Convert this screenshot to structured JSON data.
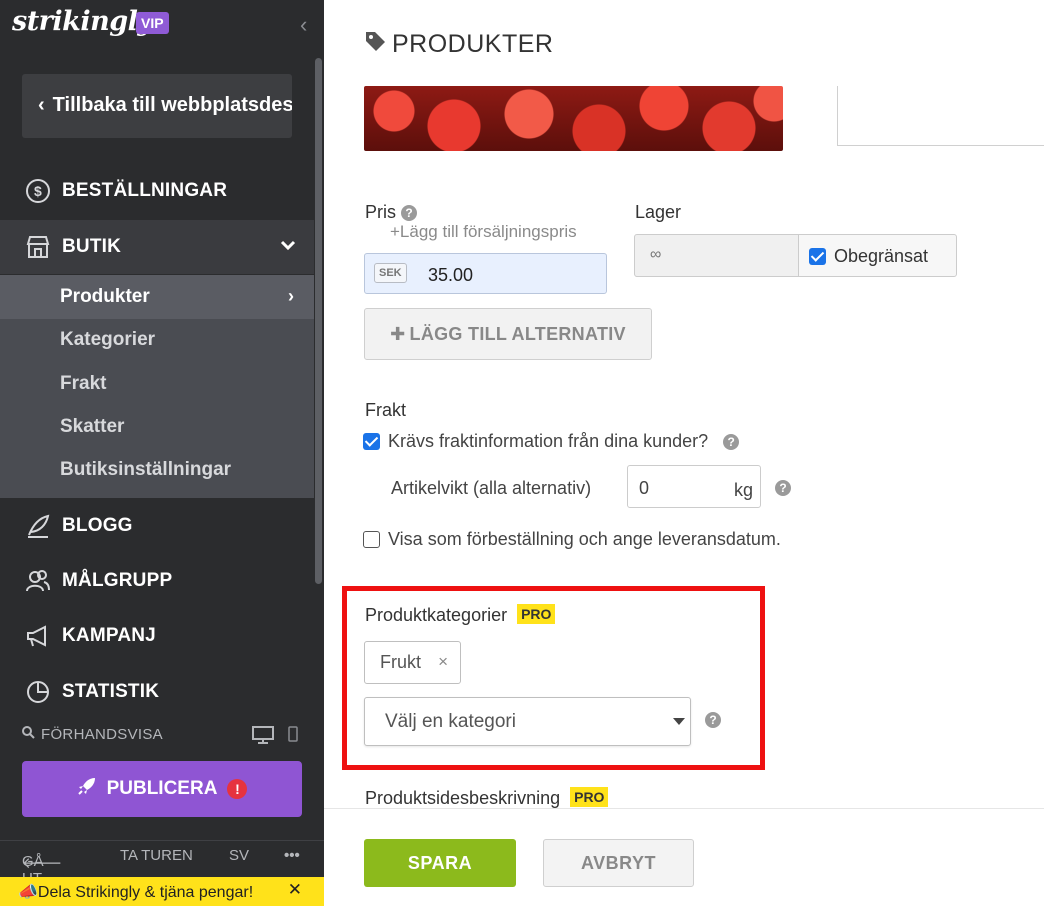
{
  "sidebar": {
    "brand": "strikingly",
    "vip_badge": "VIP",
    "back_label": "Tillbaka till webbplatsdesign",
    "nav": {
      "orders": "BESTÄLLNINGAR",
      "store": "BUTIK",
      "blog": "BLOGG",
      "audience": "MÅLGRUPP",
      "campaign": "KAMPANJ",
      "stats": "STATISTIK"
    },
    "store_sub": [
      "Produkter",
      "Kategorier",
      "Frakt",
      "Skatter",
      "Butiksinställningar"
    ],
    "preview_label": "FÖRHANDSVISA",
    "publish_label": "PUBLICERA",
    "bottom": {
      "exit": "GÅ UT",
      "tour": "TA TUREN",
      "lang": "SV",
      "more": "•••"
    },
    "promo": "Dela Strikingly & tjäna pengar!"
  },
  "main": {
    "title": "PRODUKTER",
    "price_label": "Pris",
    "add_sale_price": "+Lägg till försäljningspris",
    "currency": "SEK",
    "price_value": "35.00",
    "stock_label": "Lager",
    "stock_value": "∞",
    "unlimited_label": "Obegränsat",
    "add_variant": "LÄGG TILL ALTERNATIV",
    "shipping_label": "Frakt",
    "shipping_required": "Krävs fraktinformation från dina kunder?",
    "weight_label": "Artikelvikt (alla alternativ)",
    "weight_value": "0",
    "weight_unit": "kg",
    "preorder_label": "Visa som förbeställning och ange leveransdatum.",
    "categories_label": "Produktkategorier",
    "pro_badge": "PRO",
    "category_chip": "Frukt",
    "category_placeholder": "Välj en kategori",
    "page_desc_label": "Produktsidesbeskrivning",
    "save": "SPARA",
    "cancel": "AVBRYT"
  },
  "colors": {
    "sidebar_bg": "#2b2c2e",
    "publish": "#8f55d3",
    "save": "#8cba1c",
    "pro_badge": "#ffe21a",
    "highlight": "#ee1111"
  }
}
